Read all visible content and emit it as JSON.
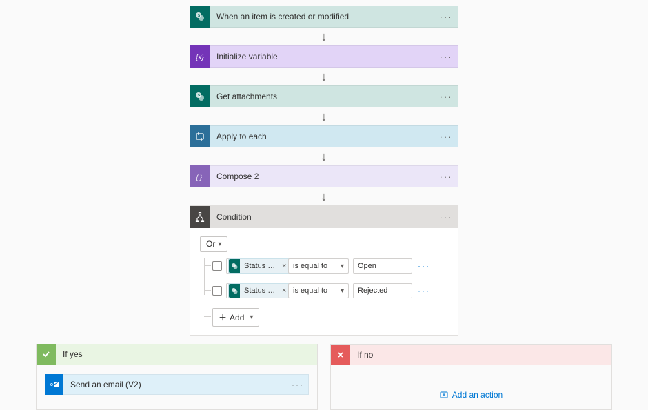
{
  "steps": [
    {
      "label": "When an item is created or modified",
      "theme": "teal",
      "icon": "sharepoint"
    },
    {
      "label": "Initialize variable",
      "theme": "purpleA",
      "icon": "variable"
    },
    {
      "label": "Get attachments",
      "theme": "teal",
      "icon": "sharepoint"
    },
    {
      "label": "Apply to each",
      "theme": "blue",
      "icon": "loop"
    },
    {
      "label": "Compose 2",
      "theme": "purpleB",
      "icon": "compose"
    }
  ],
  "condition": {
    "title": "Condition",
    "group_operator": "Or",
    "rules": [
      {
        "token": "Status Va...",
        "operator": "is equal to",
        "value": "Open"
      },
      {
        "token": "Status Va...",
        "operator": "is equal to",
        "value": "Rejected"
      }
    ],
    "add_label": "Add"
  },
  "branches": {
    "yes": {
      "label": "If yes",
      "action": {
        "label": "Send an email (V2)",
        "icon": "outlook"
      }
    },
    "no": {
      "label": "If no",
      "add_action": "Add an action"
    }
  }
}
